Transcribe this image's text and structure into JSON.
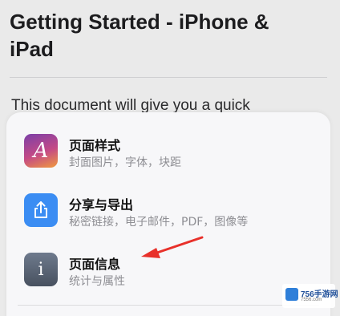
{
  "document": {
    "title": "Getting Started - iPhone & iPad",
    "body_text": "This document will give you a quick"
  },
  "menu": {
    "items": [
      {
        "title": "页面样式",
        "subtitle": "封面图片，字体，块距",
        "icon": "style-icon",
        "glyph": "A"
      },
      {
        "title": "分享与导出",
        "subtitle": "秘密链接，电子邮件，PDF，图像等",
        "icon": "share-icon"
      },
      {
        "title": "页面信息",
        "subtitle": "统计与属性",
        "icon": "info-icon",
        "glyph": "i"
      }
    ]
  },
  "annotation": {
    "arrow_color": "#e8302a"
  },
  "watermark": {
    "text": "756手游网",
    "sub": "7556.com"
  },
  "colors": {
    "share_icon": "#3b8df3",
    "background": "#eaeaea",
    "sheet": "#f7f7f9"
  }
}
